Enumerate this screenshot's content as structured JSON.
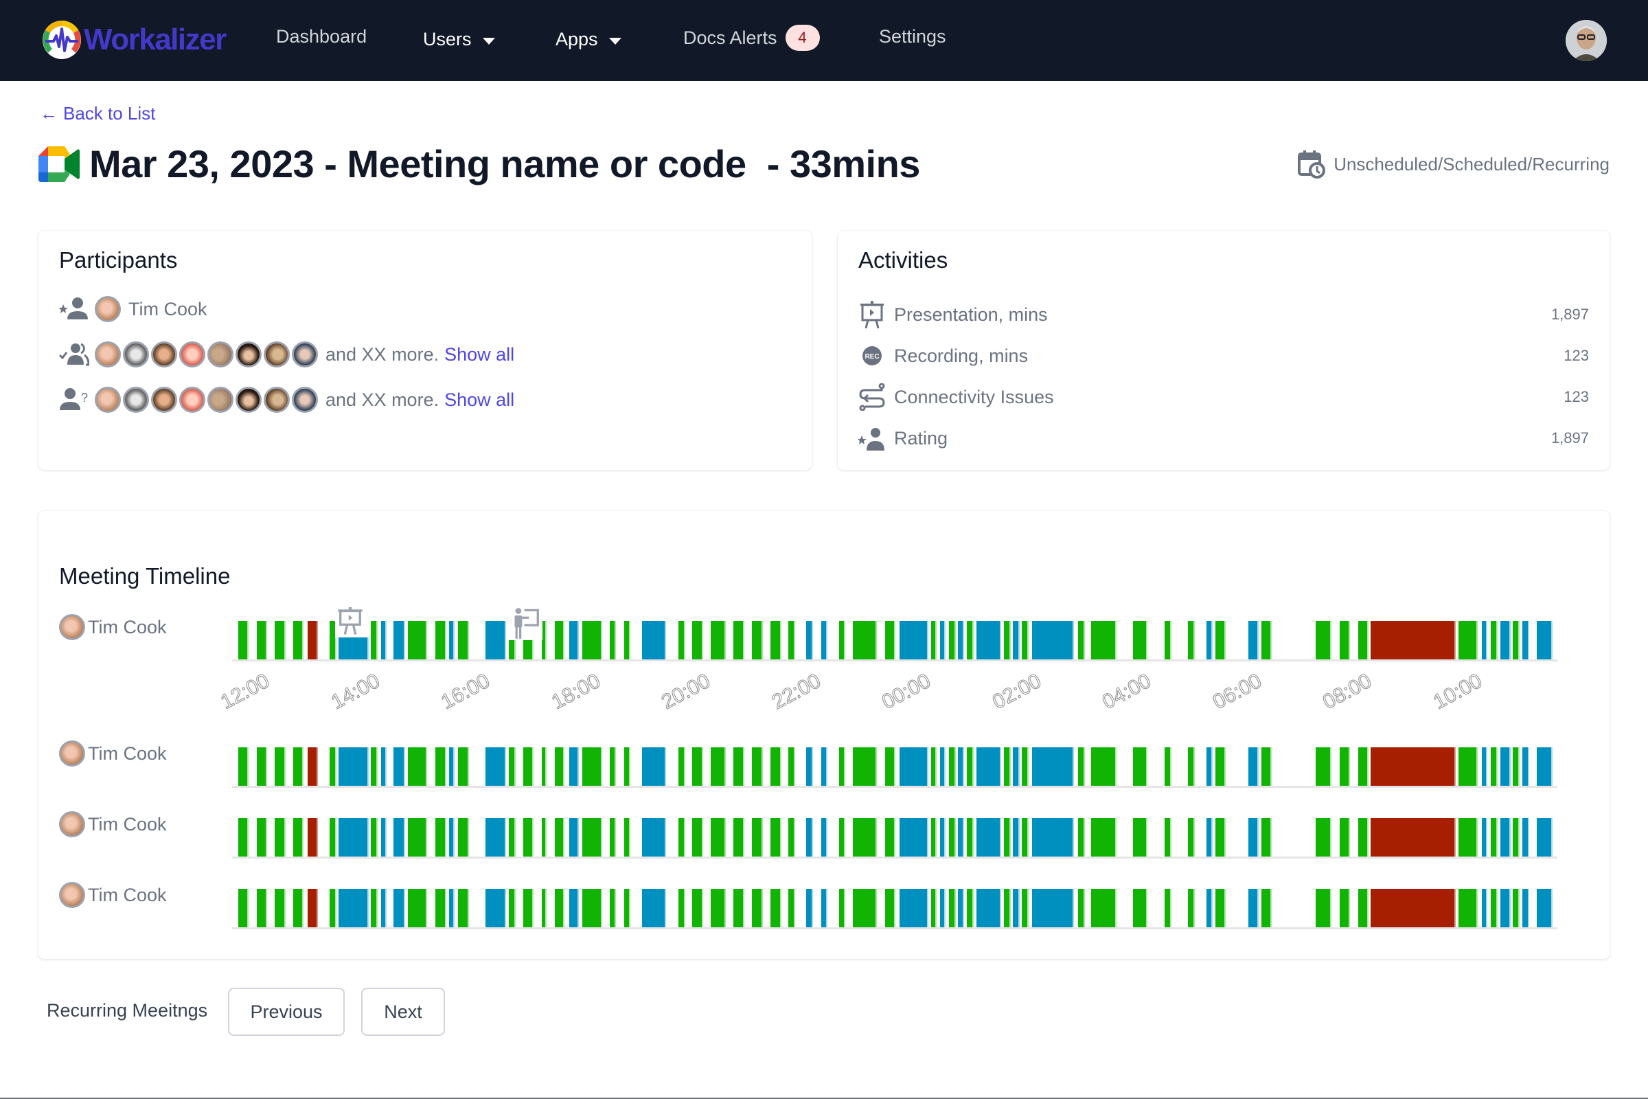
{
  "navbar": {
    "brand": "Workalizer",
    "items": [
      {
        "label": "Dashboard",
        "has_dropdown": false
      },
      {
        "label": "Users",
        "has_dropdown": true
      },
      {
        "label": "Apps",
        "has_dropdown": true
      },
      {
        "label": "Docs Alerts",
        "has_dropdown": false,
        "badge": "4"
      },
      {
        "label": "Settings",
        "has_dropdown": false
      }
    ],
    "avatar_icon": "user-avatar"
  },
  "header": {
    "back_link": "Back to List",
    "back_icon": "arrow-left-icon",
    "app_icon": "google-meet-icon",
    "title": "Mar 23, 2023 - Meeting name or code  - 33mins",
    "meeting_type": "Unscheduled/Scheduled/Recurring",
    "meeting_type_icon": "calendar-clock-icon"
  },
  "participants": {
    "title": "Participants",
    "host": {
      "icon": "host-user-star-icon",
      "name": "Tim Cook"
    },
    "attended": {
      "icon": "users-check-icon",
      "avatar_count": 8,
      "more_text": "and XX more.",
      "link": "Show all"
    },
    "unknown": {
      "icon": "user-question-icon",
      "avatar_count": 8,
      "more_text": "and XX more.",
      "link": "Show all"
    }
  },
  "activities": {
    "title": "Activities",
    "items": [
      {
        "icon": "presentation-icon",
        "label": "Presentation, mins",
        "value": "1,897"
      },
      {
        "icon": "recording-icon",
        "label": "Recording, mins",
        "value": "123"
      },
      {
        "icon": "connectivity-icon",
        "label": "Connectivity Issues",
        "value": "123"
      },
      {
        "icon": "rating-user-icon",
        "label": "Rating",
        "value": "1,897"
      }
    ]
  },
  "timeline": {
    "title": "Meeting Timeline",
    "rows": [
      {
        "name": "Tim Cook",
        "markers": [
          "presentation-icon",
          "presenter-icon"
        ]
      },
      {
        "name": "Tim Cook",
        "markers": []
      },
      {
        "name": "Tim Cook",
        "markers": []
      },
      {
        "name": "Tim Cook",
        "markers": []
      }
    ],
    "ticks": [
      "12:00",
      "14:00",
      "16:00",
      "18:00",
      "20:00",
      "22:00",
      "00:00",
      "02:00",
      "04:00",
      "06:00",
      "08:00",
      "10:00"
    ],
    "colors": {
      "green": "#12b404",
      "blue": "#0090bf",
      "red": "#a51f00"
    },
    "segments": [
      [
        "g",
        347,
        360
      ],
      [
        "g",
        374,
        387
      ],
      [
        "g",
        400,
        414
      ],
      [
        "g",
        427,
        440
      ],
      [
        "r",
        448,
        461
      ],
      [
        "g",
        480,
        488
      ],
      [
        "b",
        493,
        535
      ],
      [
        "g",
        540,
        548
      ],
      [
        "b",
        555,
        561
      ],
      [
        "b",
        573,
        588
      ],
      [
        "g",
        594,
        620
      ],
      [
        "g",
        634,
        648
      ],
      [
        "b",
        654,
        660
      ],
      [
        "g",
        667,
        681
      ],
      [
        "b",
        707,
        735
      ],
      [
        "g",
        741,
        749
      ],
      [
        "g",
        762,
        775
      ],
      [
        "g",
        789,
        794
      ],
      [
        "g",
        808,
        820
      ],
      [
        "b",
        829,
        841
      ],
      [
        "g",
        848,
        875
      ],
      [
        "g",
        888,
        895
      ],
      [
        "g",
        909,
        916
      ],
      [
        "b",
        935,
        968
      ],
      [
        "g",
        988,
        996
      ],
      [
        "g",
        1008,
        1022
      ],
      [
        "g",
        1035,
        1055
      ],
      [
        "g",
        1068,
        1082
      ],
      [
        "g",
        1095,
        1109
      ],
      [
        "g",
        1122,
        1136
      ],
      [
        "g",
        1148,
        1156
      ],
      [
        "b",
        1174,
        1182
      ],
      [
        "b",
        1196,
        1203
      ],
      [
        "g",
        1222,
        1229
      ],
      [
        "g",
        1242,
        1275
      ],
      [
        "g",
        1289,
        1302
      ],
      [
        "b",
        1310,
        1350
      ],
      [
        "g",
        1356,
        1362
      ],
      [
        "b",
        1369,
        1375
      ],
      [
        "g",
        1382,
        1390
      ],
      [
        "b",
        1395,
        1402
      ],
      [
        "g",
        1408,
        1416
      ],
      [
        "b",
        1422,
        1456
      ],
      [
        "g",
        1462,
        1470
      ],
      [
        "b",
        1475,
        1483
      ],
      [
        "g",
        1488,
        1496
      ],
      [
        "b",
        1503,
        1562
      ],
      [
        "g",
        1570,
        1578
      ],
      [
        "g",
        1589,
        1624
      ],
      [
        "g",
        1650,
        1669
      ],
      [
        "g",
        1696,
        1704
      ],
      [
        "g",
        1730,
        1738
      ],
      [
        "b",
        1757,
        1764
      ],
      [
        "g",
        1770,
        1783
      ],
      [
        "b",
        1818,
        1831
      ],
      [
        "g",
        1837,
        1850
      ],
      [
        "g",
        1916,
        1937
      ],
      [
        "g",
        1951,
        1964
      ],
      [
        "g",
        1978,
        1991
      ],
      [
        "r",
        1996,
        2118
      ],
      [
        "g",
        2124,
        2150
      ],
      [
        "b",
        2158,
        2164
      ],
      [
        "g",
        2171,
        2179
      ],
      [
        "b",
        2185,
        2198
      ],
      [
        "g",
        2203,
        2211
      ],
      [
        "b",
        2217,
        2225
      ],
      [
        "b",
        2238,
        2259
      ]
    ]
  },
  "footer": {
    "label": "Recurring Meeitngs",
    "previous": "Previous",
    "next": "Next"
  }
}
